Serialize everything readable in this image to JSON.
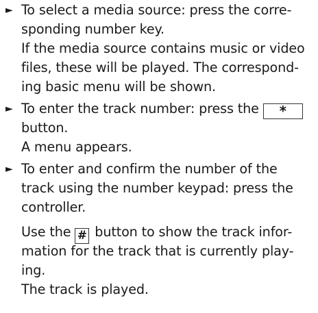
{
  "doc": {
    "bullet_glyph": "►",
    "keys": {
      "star": "*",
      "hash": "#"
    },
    "step1": {
      "line1": "To select a media source: press the corre-",
      "line2": "sponding number key."
    },
    "result1": {
      "line1": "If the media source contains music or video",
      "line2": "files, these will be played. The correspond-",
      "line3": "ing basic menu will be shown."
    },
    "step2": {
      "line1_before": "To enter the track number: press the ",
      "line2": "button."
    },
    "result2": {
      "line1": "A menu appears."
    },
    "step3": {
      "line1": "To enter and confirm the number of the",
      "line2": "track using the number keypad: press the",
      "line3": "controller."
    },
    "note3": {
      "line1_before": "Use the ",
      "line1_after": " button to show the track infor-",
      "line2": "mation for the track that is currently play-",
      "line3": "ing."
    },
    "result3": {
      "line1": "The track is played."
    }
  }
}
